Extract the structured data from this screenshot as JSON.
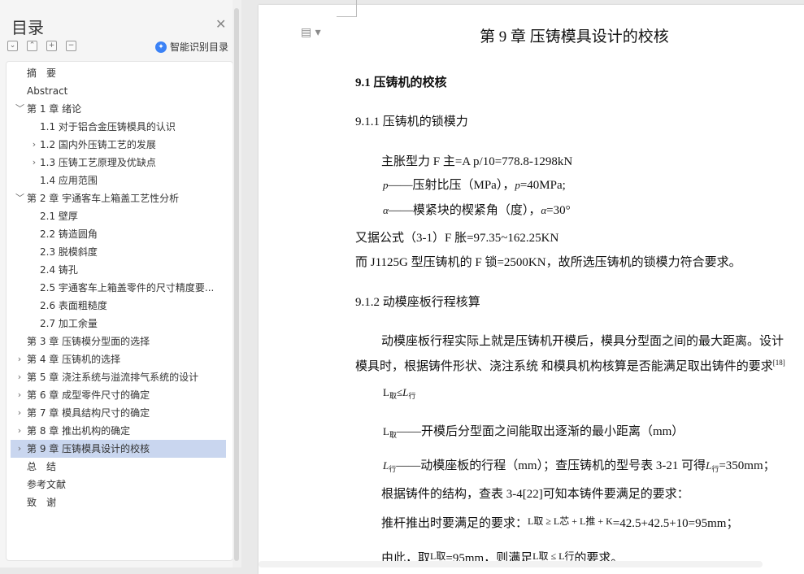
{
  "nav": {
    "title": "目录",
    "close_icon": "close-icon",
    "ai_label": "智能识别目录",
    "items": [
      {
        "label": "摘　要",
        "level": 0,
        "arrow": ""
      },
      {
        "label": "Abstract",
        "level": 0,
        "arrow": ""
      },
      {
        "label": "第 1 章  绪论",
        "level": 0,
        "arrow": "﹀"
      },
      {
        "label": "1.1  对于铝合金压铸模具的认识",
        "level": 1,
        "arrow": ""
      },
      {
        "label": "1.2  国内外压铸工艺的发展",
        "level": 1,
        "arrow": "›"
      },
      {
        "label": "1.3  压铸工艺原理及优缺点",
        "level": 1,
        "arrow": "›"
      },
      {
        "label": "1.4  应用范围",
        "level": 1,
        "arrow": ""
      },
      {
        "label": "第 2 章  宇通客车上箱盖工艺性分析",
        "level": 0,
        "arrow": "﹀"
      },
      {
        "label": "2.1 壁厚",
        "level": 1,
        "arrow": ""
      },
      {
        "label": "2.2 铸造圆角",
        "level": 1,
        "arrow": ""
      },
      {
        "label": "2.3 脱模斜度",
        "level": 1,
        "arrow": ""
      },
      {
        "label": "2.4 铸孔",
        "level": 1,
        "arrow": ""
      },
      {
        "label": "2.5 宇通客车上箱盖零件的尺寸精度要...",
        "level": 1,
        "arrow": ""
      },
      {
        "label": "2.6 表面粗糙度",
        "level": 1,
        "arrow": ""
      },
      {
        "label": "2.7 加工余量",
        "level": 1,
        "arrow": ""
      },
      {
        "label": "第 3 章  压铸模分型面的选择",
        "level": 0,
        "arrow": ""
      },
      {
        "label": "第 4 章  压铸机的选择",
        "level": 0,
        "arrow": "›"
      },
      {
        "label": "第 5 章  浇注系统与溢流排气系统的设计",
        "level": 0,
        "arrow": "›"
      },
      {
        "label": "第 6 章  成型零件尺寸的确定",
        "level": 0,
        "arrow": "›"
      },
      {
        "label": "第 7 章  模具结构尺寸的确定",
        "level": 0,
        "arrow": "›"
      },
      {
        "label": "第 8 章  推出机构的确定",
        "level": 0,
        "arrow": "›"
      },
      {
        "label": "第 9 章  压铸模具设计的校核",
        "level": 0,
        "arrow": "›",
        "selected": true
      },
      {
        "label": "总　结",
        "level": 0,
        "arrow": ""
      },
      {
        "label": "参考文献",
        "level": 0,
        "arrow": ""
      },
      {
        "label": "致　谢",
        "level": 0,
        "arrow": ""
      }
    ]
  },
  "doc": {
    "chapter_title": "第 9 章  压铸模具设计的校核",
    "s91": "9.1  压铸机的校核",
    "s911": "9.1.1  压铸机的锁模力",
    "l1": "主胀型力  F 主=A p/10=778.8-1298kN",
    "l2_sym": "p",
    "l2_text": "——压射比压（MPa），",
    "l2_sym2": "p",
    "l2_tail": "=40MPa;",
    "l3_sym": "α",
    "l3_text": "——模紧块的楔紧角（度），",
    "l3_sym2": "α",
    "l3_tail": "=30°",
    "l4": "又据公式（3-1）F 胀=97.35~162.25KN",
    "l5": "而 J1125G 型压铸机的 F 锁=2500KN，故所选压铸机的锁模力符合要求。",
    "s912": "9.1.2  动模座板行程核算",
    "p1a": "动模座板行程实际上就是压铸机开模后，模具分型面之间的最大距离。设计",
    "p1b": "模具时，根据铸件形状、浇注系统 和模具机构核算是否能满足取出铸件的要求",
    "p1ref": "[18]",
    "f1_L": "L",
    "f1_sub": "取",
    "f1_op": "≤",
    "f1_L2": "L",
    "f1_sub2": "行",
    "f2_L": "L",
    "f2_sub": "取",
    "f2_text": "——开模后分型面之间能取出逐渐的最小距离（mm）",
    "f3_L": "L",
    "f3_sub": "行",
    "f3_text": "——动模座板的行程（mm）；查压铸机的型号表 3-21 可得",
    "f3_L2": "L",
    "f3_sub2": "行",
    "f3_tail": "=350mm；",
    "l6": "根据铸件的结构，查表 3-4[22]可知本铸件要满足的要求：",
    "l7a": "推杆推出时要满足的要求：",
    "l7f": "L取 ≥ L芯 + L推 + K",
    "l7b": "=42.5+42.5+10=95mm；",
    "l8a": "由此，取",
    "l8f": "L取",
    "l8b": "=95mm，则满足",
    "l8f2": "L取 ≤ L行",
    "l8c": "的要求。"
  }
}
